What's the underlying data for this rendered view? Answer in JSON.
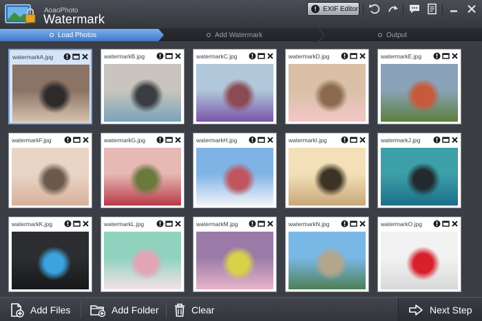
{
  "app": {
    "subtitle": "AoaoPhoto",
    "title": "Watermark"
  },
  "toolbar": {
    "exif_label": "EXIF Editor",
    "icons": [
      "undo-icon",
      "redo-icon",
      "chat-icon",
      "note-icon",
      "minimize-icon",
      "close-icon"
    ]
  },
  "steps": [
    {
      "label": "Load Photos",
      "active": true
    },
    {
      "label": "Add Watermark",
      "active": false
    },
    {
      "label": "Output",
      "active": false
    }
  ],
  "photos": [
    {
      "name": "watermarkA.jpg",
      "selected": true,
      "colors": [
        "#8b7466",
        "#d9c3b0",
        "#2e2a2a"
      ]
    },
    {
      "name": "watermarkB.jpg",
      "selected": false,
      "colors": [
        "#c9c5be",
        "#7aa3b9",
        "#3a3d42"
      ]
    },
    {
      "name": "watermarkC.jpg",
      "selected": false,
      "colors": [
        "#b0c8da",
        "#7a55a9",
        "#8c4a55"
      ]
    },
    {
      "name": "watermarkD.jpg",
      "selected": false,
      "colors": [
        "#d9c0a7",
        "#f2c7c7",
        "#8b6a4d"
      ]
    },
    {
      "name": "watermarkE.jpg",
      "selected": false,
      "colors": [
        "#8aa3b8",
        "#5b7f3e",
        "#c65a3b"
      ]
    },
    {
      "name": "watermarkF.jpg",
      "selected": false,
      "colors": [
        "#e8d5c6",
        "#d8b19a",
        "#6b5a4c"
      ]
    },
    {
      "name": "watermarkG.jpg",
      "selected": false,
      "colors": [
        "#e6b9b4",
        "#b83a48",
        "#6a7a3c"
      ]
    },
    {
      "name": "watermarkH.jpg",
      "selected": false,
      "colors": [
        "#7fb3e6",
        "#f1f4f8",
        "#c05560"
      ]
    },
    {
      "name": "watermarkI.jpg",
      "selected": false,
      "colors": [
        "#f3e0b8",
        "#c8a778",
        "#3c3326"
      ]
    },
    {
      "name": "watermarkJ.jpg",
      "selected": false,
      "colors": [
        "#3d9fa8",
        "#1c6f8a",
        "#222a30"
      ]
    },
    {
      "name": "watermarkK.jpg",
      "selected": false,
      "colors": [
        "#2b2d30",
        "#171819",
        "#3aa3e0"
      ]
    },
    {
      "name": "watermarkL.jpg",
      "selected": false,
      "colors": [
        "#8fd3bf",
        "#f5e1e8",
        "#e3a4b6"
      ]
    },
    {
      "name": "watermarkM.jpg",
      "selected": false,
      "colors": [
        "#9b7aa8",
        "#e8b4c8",
        "#d8d24a"
      ]
    },
    {
      "name": "watermarkN.jpg",
      "selected": false,
      "colors": [
        "#79b8e6",
        "#4f7f55",
        "#b3a68c"
      ]
    },
    {
      "name": "watermarkO.jpg",
      "selected": false,
      "colors": [
        "#f2f2f2",
        "#d8d8d8",
        "#d81f2a"
      ]
    }
  ],
  "bottom": {
    "add_files": "Add Files",
    "add_folder": "Add Folder",
    "clear": "Clear",
    "next": "Next Step"
  }
}
